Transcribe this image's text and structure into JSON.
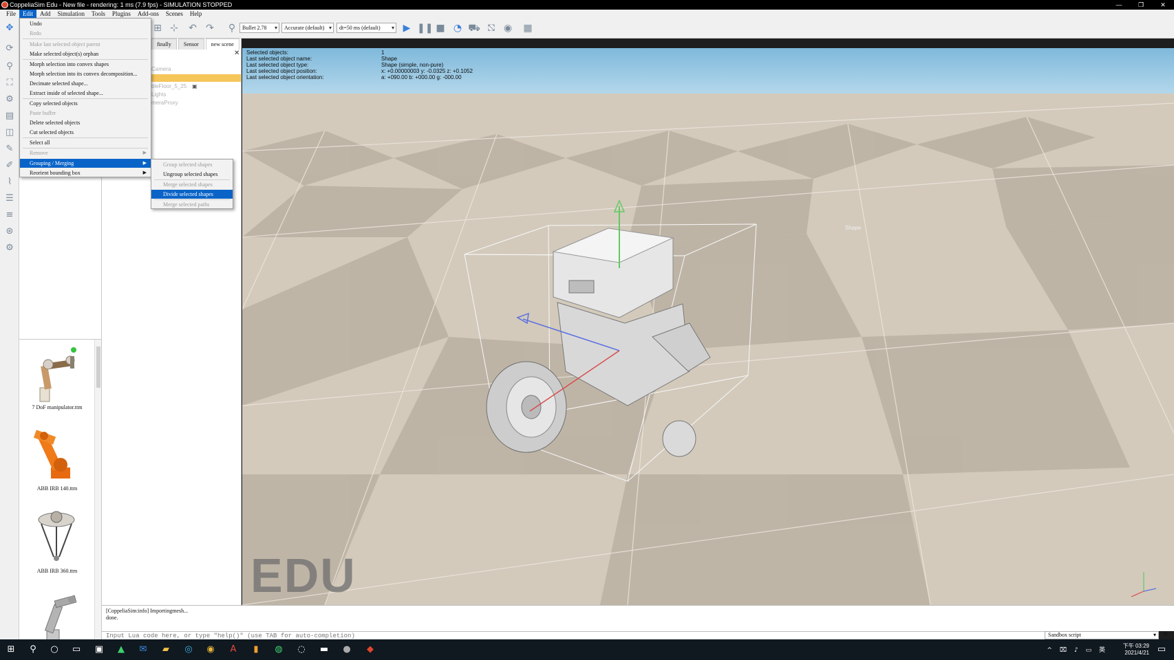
{
  "window": {
    "title": "CoppeliaSim Edu - New file - rendering: 1 ms (7.9 fps) - SIMULATION STOPPED",
    "controls": [
      "—",
      "❐",
      "✕"
    ]
  },
  "menubar": [
    "File",
    "Edit",
    "Add",
    "Simulation",
    "Tools",
    "Plugins",
    "Add-ons",
    "Scenes",
    "Help"
  ],
  "toolbar": {
    "engine": "Bullet 2.78",
    "accuracy": "Accurate (default)",
    "timestep": "dt=50 ms (default)"
  },
  "edit_menu": {
    "items": [
      {
        "label": "Undo",
        "enabled": true
      },
      {
        "label": "Redo",
        "enabled": false
      },
      {
        "label": "Make last selected object parent",
        "enabled": false
      },
      {
        "label": "Make selected object(s) orphan",
        "enabled": true
      },
      {
        "label": "Morph selection into convex shapes",
        "enabled": true
      },
      {
        "label": "Morph selection into its convex decomposition...",
        "enabled": true
      },
      {
        "label": "Decimate selected shape...",
        "enabled": true
      },
      {
        "label": "Extract inside of selected shape...",
        "enabled": true
      },
      {
        "label": "Copy selected objects",
        "enabled": true
      },
      {
        "label": "Paste buffer",
        "enabled": false
      },
      {
        "label": "Delete selected objects",
        "enabled": true
      },
      {
        "label": "Cut selected objects",
        "enabled": true
      },
      {
        "label": "Select all",
        "enabled": true
      },
      {
        "label": "Remove",
        "enabled": false
      },
      {
        "label": "Grouping / Merging",
        "enabled": true
      },
      {
        "label": "Reorient bounding box",
        "enabled": true
      }
    ]
  },
  "submenu": {
    "items": [
      {
        "label": "Group selected shapes",
        "enabled": false
      },
      {
        "label": "Ungroup selected shapes",
        "enabled": true
      },
      {
        "label": "Merge selected shapes",
        "enabled": false
      },
      {
        "label": "Divide selected shapes",
        "enabled": true
      },
      {
        "label": "Merge selected paths",
        "enabled": false
      }
    ]
  },
  "scene_tabs": [
    "finally",
    "Sensor",
    "new scene"
  ],
  "hierarchy": [
    "Camera",
    "",
    "bleFloor_5_25",
    "Lights",
    "meraProxy"
  ],
  "info": [
    {
      "k": "Selected objects:",
      "v": "1"
    },
    {
      "k": "Last selected object name:",
      "v": "Shape"
    },
    {
      "k": "Last selected object type:",
      "v": "Shape (simple, non-pure)"
    },
    {
      "k": "Last selected object position:",
      "v": "x: +0.00000003   y: -0.0325   z: +0.1052"
    },
    {
      "k": "Last selected object orientation:",
      "v": "a: +090.00   b: +000.00   g: -000.00"
    }
  ],
  "viewport": {
    "watermark": "EDU",
    "object_label": "Shape"
  },
  "models": [
    {
      "label": "7 DoF manipulator.ttm"
    },
    {
      "label": "ABB IRB 140.ttm"
    },
    {
      "label": "ABB IRB 360.ttm"
    },
    {
      "label": ""
    }
  ],
  "console": {
    "line1": "[CoppeliaSim:info] Importingmesh...",
    "line2": "done.",
    "input_placeholder": "Input Lua code here, or type \"help()\" (use TAB for auto-completion)",
    "script_select": "Sandbox script"
  },
  "taskbar": {
    "time": "下午 03:29",
    "date": "2021/4/21"
  }
}
